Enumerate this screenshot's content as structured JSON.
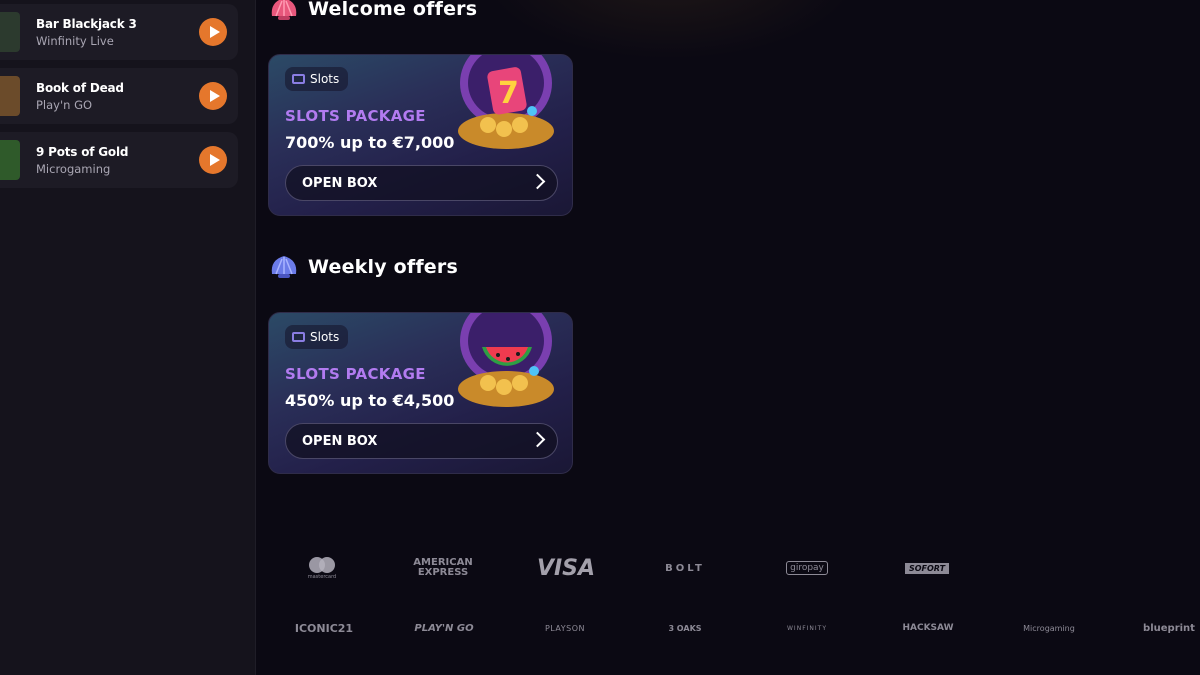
{
  "sidebar": {
    "games": [
      {
        "title": "Bar Blackjack 3",
        "provider": "Winfinity Live",
        "thumb_color": "#2c3a2e"
      },
      {
        "title": "Book of Dead",
        "provider": "Play'n GO",
        "thumb_color": "#6b4b2a"
      },
      {
        "title": "9 Pots of Gold",
        "provider": "Microgaming",
        "thumb_color": "#2f5a2a"
      }
    ]
  },
  "welcome": {
    "heading": "Welcome offers",
    "card": {
      "tag": "Slots",
      "package": "SLOTS PACKAGE",
      "amount": "700% up to €7,000",
      "button": "OPEN BOX",
      "art": "slot-seven-shell"
    }
  },
  "weekly": {
    "heading": "Weekly offers",
    "card": {
      "tag": "Slots",
      "package": "SLOTS PACKAGE",
      "amount": "450% up to €4,500",
      "button": "OPEN BOX",
      "art": "watermelon-shell"
    }
  },
  "payments": [
    "mastercard",
    "AMERICAN EXPRESS",
    "VISA",
    "BOLT",
    "giropay",
    "SOFORT"
  ],
  "providers": [
    "ICONIC21",
    "PLAY'N GO",
    "PLAYSON",
    "3 OAKS",
    "WINFINITY",
    "HACKSAW",
    "Microgaming",
    "blueprint"
  ],
  "colors": {
    "accent": "#e5772c",
    "package": "#b27bf0",
    "bg": "#0b0913"
  }
}
